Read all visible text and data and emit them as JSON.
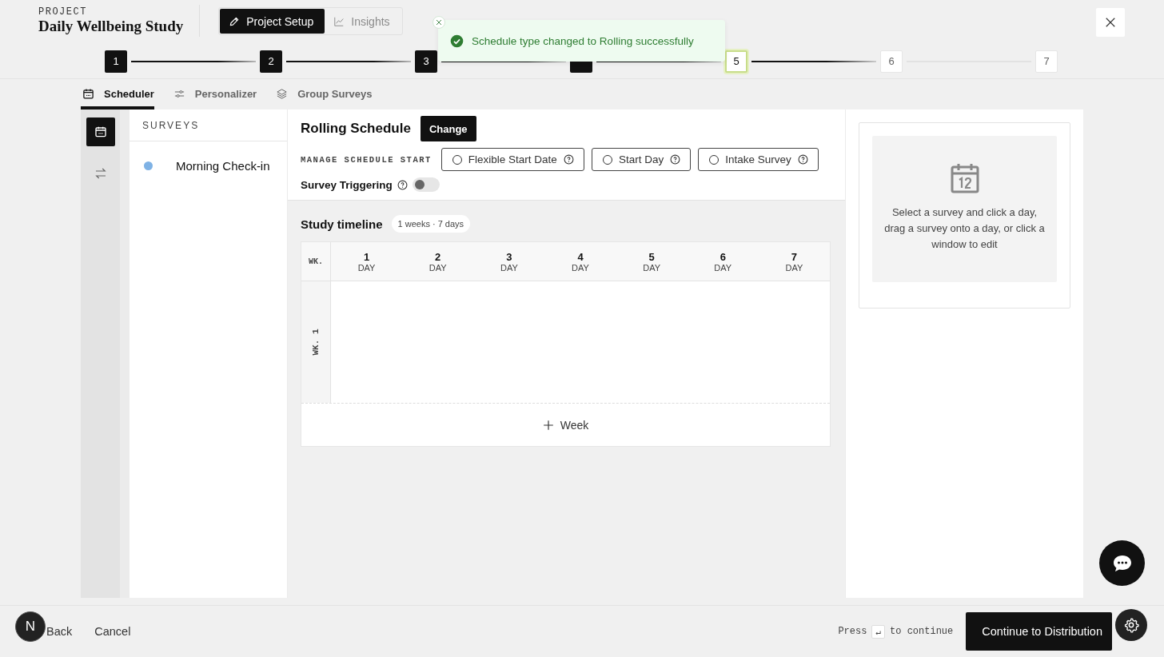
{
  "project": {
    "label": "PROJECT",
    "title": "Daily Wellbeing Study"
  },
  "mode_tabs": [
    {
      "label": "Project Setup",
      "selected": true
    },
    {
      "label": "Insights",
      "selected": false
    }
  ],
  "toast": {
    "message": "Schedule type changed to Rolling successfully"
  },
  "steps": [
    {
      "label": "1",
      "completed": true,
      "selected": false
    },
    {
      "label": "2",
      "completed": true,
      "selected": false
    },
    {
      "label": "3",
      "completed": true,
      "selected": false
    },
    {
      "completed": true,
      "selected": false
    },
    {
      "label": "5",
      "completed": false,
      "selected": true
    },
    {
      "label": "6",
      "completed": false,
      "selected": false
    },
    {
      "label": "7",
      "completed": false,
      "selected": false
    }
  ],
  "view_tabs": [
    {
      "label": "Scheduler",
      "kind": "calendar",
      "selected": true
    },
    {
      "label": "Personalizer",
      "kind": "sliders",
      "selected": false
    },
    {
      "label": "Group Surveys",
      "kind": "layers",
      "selected": false
    }
  ],
  "rail": [
    {
      "kind": "calendar",
      "selected": true
    },
    {
      "kind": "swap",
      "selected": false
    }
  ],
  "surveys": {
    "heading": "SURVEYS",
    "items": [
      {
        "name": "Morning Check-in",
        "color": "#7fb2e5"
      }
    ]
  },
  "schedule": {
    "title": "Rolling Schedule",
    "change_button": "Change",
    "start_label": "MANAGE SCHEDULE START",
    "start_options": [
      {
        "label": "Flexible Start Date",
        "selected": false
      },
      {
        "label": "Start Day",
        "selected": false
      },
      {
        "label": "Intake Survey",
        "selected": false
      }
    ],
    "triggering": {
      "label": "Survey Triggering",
      "on": false
    }
  },
  "timeline": {
    "title": "Study timeline",
    "badge": "1 weeks · 7 days",
    "corner": "WK.",
    "days": [
      {
        "number": "1",
        "label": "DAY"
      },
      {
        "number": "2",
        "label": "DAY"
      },
      {
        "number": "3",
        "label": "DAY"
      },
      {
        "number": "4",
        "label": "DAY"
      },
      {
        "number": "5",
        "label": "DAY"
      },
      {
        "number": "6",
        "label": "DAY"
      },
      {
        "number": "7",
        "label": "DAY"
      }
    ],
    "weeks": [
      {
        "label": "WK. 1"
      }
    ],
    "add_week": "Week"
  },
  "editor_hint": "Select a survey and click a day, drag a survey onto a day, or click a window to edit",
  "footer": {
    "avatar": "N",
    "back": "Back",
    "cancel": "Cancel",
    "press": "Press",
    "key": "↵",
    "continue_hint": "to continue",
    "continue_button": "Continue to Distribution"
  }
}
